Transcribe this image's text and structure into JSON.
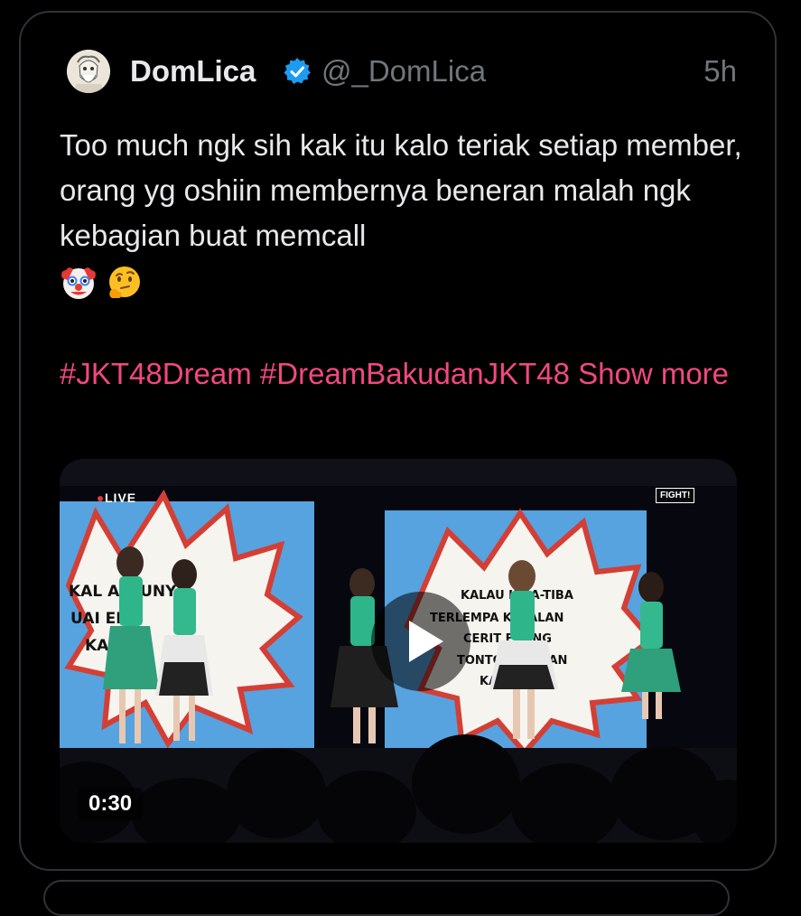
{
  "tweet": {
    "author_name": "DomLica",
    "author_handle": "@_DomLica",
    "timestamp": "5h",
    "verified": true,
    "text": "Too much ngk sih kak itu kalo teriak setiap member, orang yg oshiin membernya beneran malah ngk kebagian buat memcall",
    "emojis": [
      "clown-face",
      "thinking-face"
    ],
    "hashtags": [
      "#JKT48Dream",
      "#DreamBakudanJKT48"
    ],
    "show_more": "Show more"
  },
  "video": {
    "duration": "0:30",
    "live_badge": "LIVE",
    "fight_badge": "FIGHT!",
    "left_screen_lines": [
      "KAL   AM    UNYA",
      "UAI              ED,",
      "KA              KAI"
    ],
    "right_screen_lines": [
      "KALAU K   BA-TIBA",
      "TERLEMPA     KE JALAN",
      "CERIT      EDANG",
      "TONTO       NG AKAN",
      "KA          N?"
    ]
  },
  "colors": {
    "background": "#000000",
    "text": "#e7e9ea",
    "secondary": "#71767b",
    "hashtag": "#f3487f",
    "verified": "#1d9bf0",
    "border": "#2f3336"
  }
}
